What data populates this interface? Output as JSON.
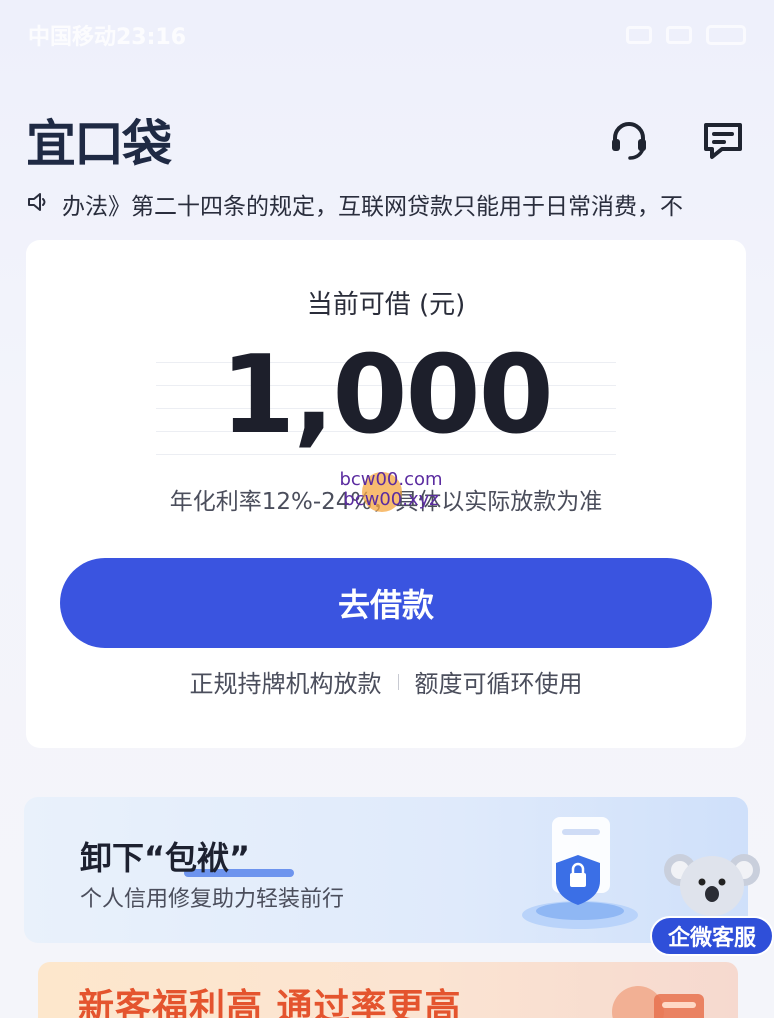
{
  "status_bar": {
    "carrier_time": "中国移动23:16"
  },
  "header": {
    "logo": "宜口袋"
  },
  "notice": {
    "text": "办法》第二十四条的规定，互联网贷款只能用于日常消费，不"
  },
  "card": {
    "label": "当前可借 (元)",
    "amount": "1,000",
    "rate": "年化利率12%-24%，具体以实际放款为准",
    "watermark": [
      "bcw00.com",
      "bcw00.xyz"
    ],
    "button": "去借款",
    "features": [
      "正规持牌机构放款",
      "额度可循环使用"
    ]
  },
  "banner": {
    "title": "卸下“包袱”",
    "subtitle": "个人信用修复助力轻装前行"
  },
  "service_float": {
    "label": "企微客服"
  },
  "promo": {
    "text": "新客福利高 通过率更高"
  },
  "colors": {
    "primary": "#3a54e0",
    "promo_text": "#e4542e"
  }
}
